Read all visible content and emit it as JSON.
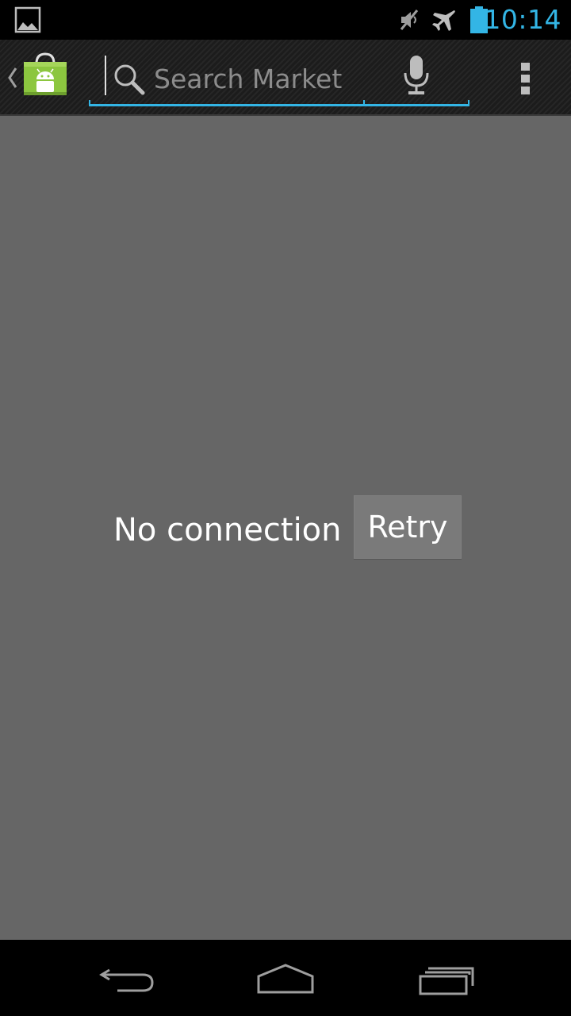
{
  "status_bar": {
    "time": "10:14",
    "icons": [
      "image-notification-icon",
      "mute-icon",
      "airplane-mode-icon",
      "battery-icon"
    ]
  },
  "action_bar": {
    "app_icon": "play-market-bag-icon",
    "search": {
      "placeholder": "Search Market",
      "value": ""
    },
    "icons": [
      "search-icon",
      "microphone-icon",
      "overflow-menu-icon"
    ]
  },
  "content": {
    "error_message": "No connection",
    "retry_label": "Retry"
  },
  "navigation": {
    "icons": [
      "back-icon",
      "home-icon",
      "recent-apps-icon"
    ]
  },
  "colors": {
    "accent": "#33b5e5",
    "background": "#666666",
    "bar": "#000000",
    "market_green": "#8cc63f"
  }
}
